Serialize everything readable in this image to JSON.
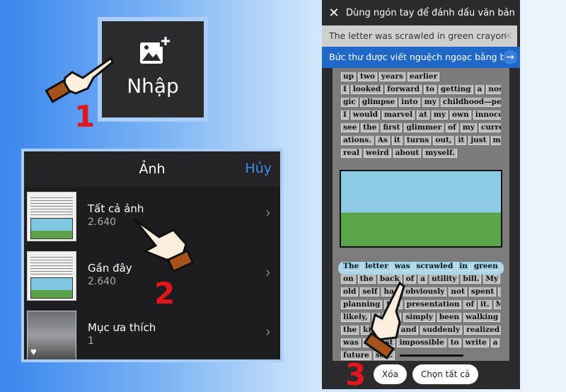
{
  "step1": {
    "number": "1",
    "button_label": "Nhập",
    "icon": "add-image-icon"
  },
  "step2": {
    "number": "2",
    "title": "Ảnh",
    "cancel": "Hủy",
    "albums": [
      {
        "name": "Tất cả ảnh",
        "count": "2.640"
      },
      {
        "name": "Gần đây",
        "count": "2.640"
      },
      {
        "name": "Mục ưa thích",
        "count": "1"
      }
    ]
  },
  "step3": {
    "number": "3",
    "header": "Dùng ngón tay để đánh dấu văn bản",
    "source_text": "The letter was scrawled in green crayon",
    "translation": "Bức thư được viết nguệch ngoạc bằng bút",
    "book_lines_top": [
      "up two years earlier",
      "I looked forward to getting a nostal-",
      "gic glimpse into my childhood—perhaps",
      "I would marvel at my own innocence or",
      "see the first glimmer of my current aspir-",
      "ations. As it turns out, it just made me feel",
      "real weird about myself."
    ],
    "highlighted_line": "The letter was scrawled in green crayon",
    "book_lines_bottom": [
      "on the back of a utility bill. My ten-year-",
      "old self had obviously not spent much time",
      "planning the presentation of it. Most",
      "likely, I had simply been walking through",
      "the kitchen and suddenly realized that it",
      "was almost impossible to write a letter to my",
      "future self."
    ],
    "clear_button": "Xóa",
    "select_all_button": "Chọn tất cả"
  },
  "colors": {
    "accent": "#1f67c9",
    "step_number": "#e3161b",
    "cancel": "#3a8ef0"
  }
}
